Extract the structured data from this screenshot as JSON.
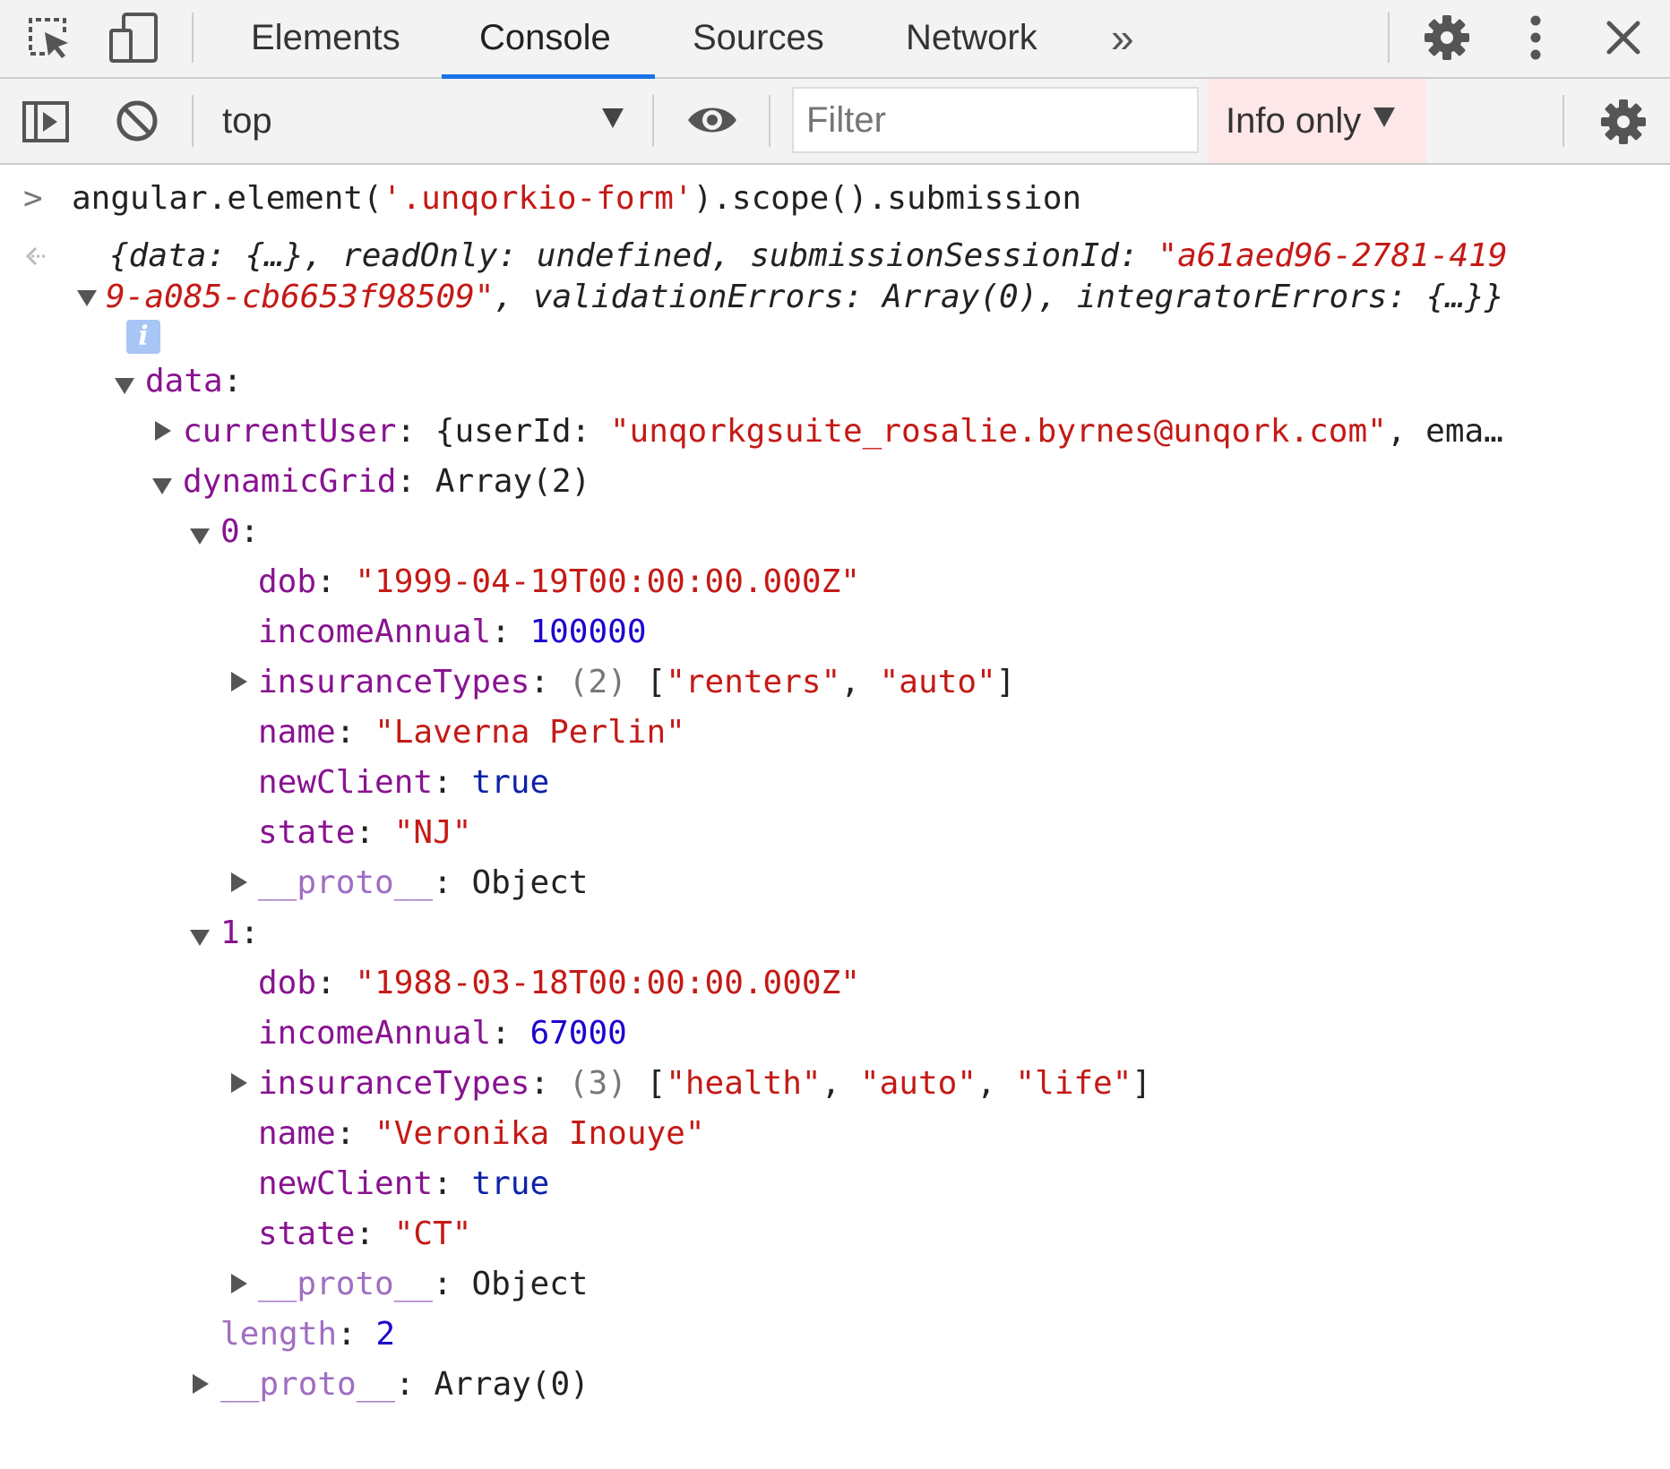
{
  "tabs": [
    {
      "label": "Elements",
      "active": false
    },
    {
      "label": "Console",
      "active": true
    },
    {
      "label": "Sources",
      "active": false
    },
    {
      "label": "Network",
      "active": false
    }
  ],
  "more_tabs": "»",
  "toolbar": {
    "context": "top",
    "filter_placeholder": "Filter",
    "levels": "Info only"
  },
  "console": {
    "input_prompt": ">",
    "input": {
      "p1": "angular.element(",
      "p2": "'.unqorkio-form'",
      "p3": ").scope().submission"
    },
    "result": {
      "l1": {
        "a": "{data: {…}, readOnly: undefined, submissionSessionId: ",
        "b": "\"a61aed96-2781-419"
      },
      "l2": {
        "a": "9-a085-cb6653f98509\"",
        "b": ", validationErrors: Array(0), integratorErrors: {…}}"
      },
      "info_badge": "i"
    },
    "tree": {
      "data_key": "data",
      "currentUser": {
        "key": "currentUser",
        "open": "{userId: ",
        "userId": "\"unqorkgsuite_rosalie.byrnes@unqork.com\"",
        "rest": ", ema…"
      },
      "dynamicGrid": {
        "key": "dynamicGrid",
        "value": "Array(2)"
      },
      "items": [
        {
          "index": "0",
          "dob": "\"1999-04-19T00:00:00.000Z\"",
          "incomeAnnual": "100000",
          "insurance_count": "(2)",
          "insurance_types": [
            "\"renters\"",
            "\"auto\""
          ],
          "name": "\"Laverna Perlin\"",
          "newClient": "true",
          "state": "\"NJ\"",
          "proto": "Object"
        },
        {
          "index": "1",
          "dob": "\"1988-03-18T00:00:00.000Z\"",
          "incomeAnnual": "67000",
          "insurance_count": "(3)",
          "insurance_types": [
            "\"health\"",
            "\"auto\"",
            "\"life\""
          ],
          "name": "\"Veronika Inouye\"",
          "newClient": "true",
          "state": "\"CT\"",
          "proto": "Object"
        }
      ],
      "length_key": "length",
      "length": "2",
      "proto_key": "__proto__",
      "array_proto": "Array(0)"
    },
    "labels": {
      "dob": "dob",
      "incomeAnnual": "incomeAnnual",
      "insuranceTypes": "insuranceTypes",
      "name": "name",
      "newClient": "newClient",
      "state": "state",
      "proto": "__proto__"
    }
  }
}
